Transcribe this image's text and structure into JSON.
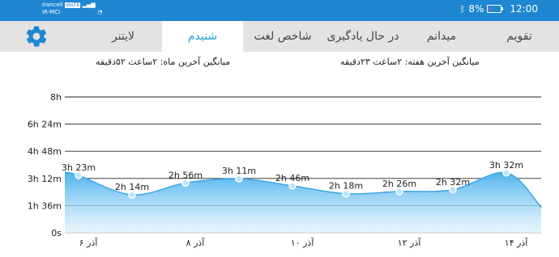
{
  "status_bar": {
    "carrier_1": "Irancell",
    "carrier_1_badge": "VoLTE",
    "carrier_2": "IR-MCI",
    "battery_percent": "8%",
    "battery_level": 0.08,
    "time": "12:00",
    "icons": [
      "signal-icon",
      "signal-icon",
      "wifi-icon",
      "bluetooth-icon",
      "battery-icon"
    ]
  },
  "header": {
    "tabs": [
      {
        "label": "تقویم",
        "active": false
      },
      {
        "label": "میدانم",
        "active": false
      },
      {
        "label": "در حال یادگیری",
        "active": false
      },
      {
        "label": "شاخص لغت",
        "active": false
      },
      {
        "label": "شنیدم",
        "active": true
      },
      {
        "label": "لایتنر",
        "active": false
      }
    ],
    "settings_icon": "gear-icon"
  },
  "stats": {
    "week_avg": "میانگین آخرین هفته: ۲ساعت ۲۳دقیقه",
    "month_avg": "میانگین آخرین ماه: ۲ساعت ۵۲دقیقه"
  },
  "colors": {
    "accent": "#2aa0d8",
    "status_bar": "#1f86d1",
    "line": "#3aa6e8",
    "marker": "#b8e6fb"
  },
  "chart_data": {
    "type": "area",
    "title": "",
    "xlabel": "",
    "ylabel": "",
    "y_ticks_minutes": [
      0,
      96,
      192,
      288,
      384,
      480
    ],
    "y_tick_labels": [
      "0s",
      "1h 36m",
      "3h 12m",
      "4h 48m",
      "6h 24m",
      "8h"
    ],
    "ylim": [
      0,
      480
    ],
    "x_tick_positions": [
      1,
      3,
      5,
      7,
      9
    ],
    "x_tick_labels": [
      "۶ آذر",
      "۸ آذر",
      "۱۰ آذر",
      "۱۲ آذر",
      "۱۴ آذر"
    ],
    "x": [
      1,
      2,
      3,
      4,
      5,
      6,
      7,
      8,
      9
    ],
    "values": [
      203,
      134,
      176,
      191,
      166,
      138,
      146,
      152,
      212
    ],
    "point_labels": [
      "3h 23m",
      "2h 14m",
      "2h 56m",
      "3h 11m",
      "2h 46m",
      "2h 18m",
      "2h 26m",
      "2h 32m",
      "3h 32m"
    ],
    "trailing_value": 90,
    "grid": false
  }
}
